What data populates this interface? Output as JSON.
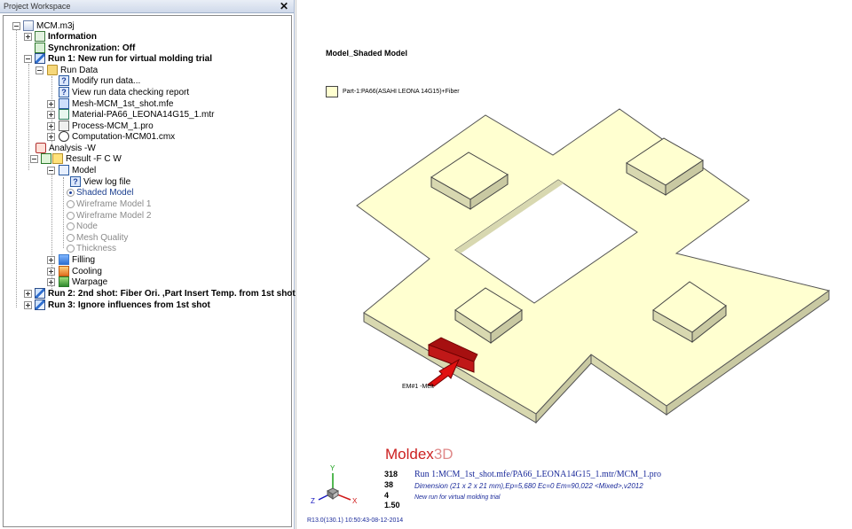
{
  "panel": {
    "title": "Project Workspace",
    "close_glyph": "✕"
  },
  "tree": [
    {
      "label": "MCM.m3j",
      "style": "normal",
      "icon": "project-icon"
    },
    {
      "label": "Information",
      "style": "bold",
      "icon": "information-icon"
    },
    {
      "label": "Synchronization: Off",
      "style": "bold",
      "icon": "sync-icon"
    },
    {
      "label": "Run 1: New run for virtual molding trial",
      "style": "bold",
      "icon": "run-icon"
    },
    {
      "label": "Run Data",
      "style": "normal",
      "icon": "folder-icon"
    },
    {
      "label": "Modify run data...",
      "style": "normal",
      "icon": "help-icon"
    },
    {
      "label": "View run data checking report",
      "style": "normal",
      "icon": "help-icon"
    },
    {
      "label": "Mesh-MCM_1st_shot.mfe",
      "style": "normal",
      "icon": "mesh-icon"
    },
    {
      "label": "Material-PA66_LEONA14G15_1.mtr",
      "style": "normal",
      "icon": "material-icon"
    },
    {
      "label": "Process-MCM_1.pro",
      "style": "normal",
      "icon": "process-icon"
    },
    {
      "label": "Computation-MCM01.cmx",
      "style": "normal",
      "icon": "computation-icon"
    },
    {
      "label": "Analysis -W",
      "style": "normal",
      "icon": "analysis-icon"
    },
    {
      "label": "Result -F C W",
      "style": "normal",
      "icon": "result-icon"
    },
    {
      "label": "Model",
      "style": "normal",
      "icon": "model-icon"
    },
    {
      "label": "View log file",
      "style": "normal",
      "icon": "help-icon"
    },
    {
      "label": "Shaded Model",
      "style": "blue",
      "icon": "radio-selected"
    },
    {
      "label": "Wireframe Model 1",
      "style": "gray",
      "icon": "radio"
    },
    {
      "label": "Wireframe Model 2",
      "style": "gray",
      "icon": "radio"
    },
    {
      "label": "Node",
      "style": "gray",
      "icon": "radio"
    },
    {
      "label": "Mesh Quality",
      "style": "gray",
      "icon": "radio"
    },
    {
      "label": "Thickness",
      "style": "gray",
      "icon": "radio"
    },
    {
      "label": "Filling",
      "style": "normal",
      "icon": "filling-icon"
    },
    {
      "label": "Cooling",
      "style": "normal",
      "icon": "cooling-icon"
    },
    {
      "label": "Warpage",
      "style": "normal",
      "icon": "warpage-icon"
    },
    {
      "label": "Run 2: 2nd shot: Fiber Ori. ,Part Insert Temp. from 1st shot",
      "style": "bold",
      "icon": "run-icon"
    },
    {
      "label": "Run 3: Ignore influences from 1st shot",
      "style": "bold",
      "icon": "run-icon"
    }
  ],
  "viewport": {
    "title": "Model_Shaded Model",
    "legend": "Part-1:PA66(ASAHI LEONA 14G15)+Fiber",
    "gate_label": "EM#1 -Melt",
    "brand_main": "Moldex",
    "brand_suffix": "3D",
    "stats": [
      "318",
      "38",
      "4",
      "1.50"
    ],
    "run_line": "Run 1:MCM_1st_shot.mfe/PA66_LEONA14G15_1.mtr/MCM_1.pro",
    "dimension_line": "Dimension (21 x 2 x 21 mm),Ep=5,680 Ec=0 Em=90,022  <Mixed>,v2012",
    "description_line": "New run for virtual molding trial",
    "version": "R13.0(130.1) 10:50:43-08-12-2014",
    "axis_y": "Y",
    "axis_x": "X",
    "axis_z": "Z",
    "part_color": "#ffffd0",
    "gate_color": "#c01818"
  }
}
